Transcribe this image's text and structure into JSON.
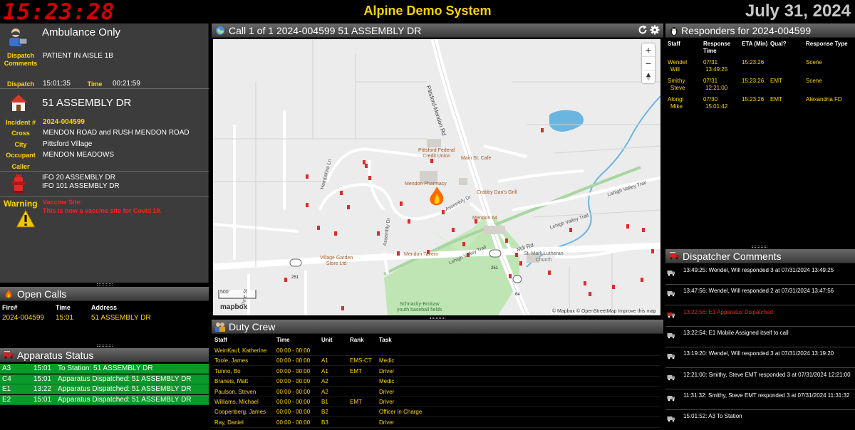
{
  "header": {
    "clock": "15:23:28",
    "system_title": "Alpine Demo System",
    "date": "July 31, 2024"
  },
  "call_info": {
    "call_type": "Ambulance Only",
    "dispatch_comments_label": "Dispatch Comments",
    "dispatch_comments": "PATIENT IN AISLE 1B",
    "dispatch_label": "Dispatch",
    "dispatch_time": "15:01:35",
    "time_label": "Time",
    "elapsed_time": "00:21:59",
    "address": "51 ASSEMBLY DR",
    "incident_label": "Incident #",
    "incident_number": "2024-004599",
    "cross_label": "Cross",
    "cross": "MENDON ROAD and RUSH MENDON ROAD",
    "city_label": "City",
    "city": "Pittsford Village",
    "occupant_label": "Occupant",
    "occupant": "MENDON MEADOWS",
    "caller_label": "Caller",
    "hydrants": [
      "IFO 20 ASSEMBLY DR",
      "IFO 101 ASSEMBLY DR"
    ],
    "warning_label": "Warning",
    "warning_title": "Vaccine Site:",
    "warning_text": "This is now a vaccine site for Covid 19."
  },
  "map_panel": {
    "title": "Call 1 of 1 2024-004599 51 ASSEMBLY DR",
    "zoom_in": "+",
    "zoom_out": "−",
    "scale": "500'",
    "attribution": "© Mapbox © OpenStreetMap  Improve this map",
    "mapbox_logo": "mapbox",
    "labels": {
      "pittsford_mendon_rd": "Pittsford-Mendon Rd",
      "hampshire_ln": "Hampshire Ln",
      "assembly_dr": "Assembly Dr",
      "lehigh_valley_trail": "Lehigh Valley Trail",
      "lehigh_valley_trail2": "Lehigh Valley Trail",
      "lehigh_valley_trail3": "Lehigh Valley Trail",
      "mill_rd": "Mill Rd",
      "pine_st": "Pine St",
      "assembly_dr2": "Assembly Dr",
      "route_251a": "251",
      "route_251b": "251",
      "route_64": "64",
      "pittsford_federal": "Pittsford Federal",
      "credit_union": "Credit Union",
      "main_st_cafe": "Main St. Cafe",
      "mendon_pharmacy": "Mendon Pharmacy",
      "crabby_dans": "Crabby Dan's Grill",
      "mendon_64": "Mendon 64",
      "village_garden": "Village Garden",
      "store_ltd": "Store Ltd",
      "mendon_tavern": "Mendon Tavern",
      "st_mark": "St. Mark Lutheran",
      "church": "Church",
      "schnacky": "Schnacky-Brokaw",
      "youth_baseball": "youth baseball fields"
    }
  },
  "responders": {
    "title": "Responders for 2024-004599",
    "columns": [
      "Staff",
      "Response Time",
      "ETA (Min)",
      "Qual?",
      "Response Type"
    ],
    "rows": [
      {
        "staff1": "Wendel",
        "staff2": "Will",
        "date": "07/31",
        "time": "13:49:25",
        "eta": "15:23:26",
        "qual": "",
        "type": "Scene"
      },
      {
        "staff1": "Smithy",
        "staff2": "Steve",
        "date": "07/31",
        "time": "12:21:00",
        "eta": "15:23:26",
        "qual": "EMT",
        "type": "Scene"
      },
      {
        "staff1": "Alongi",
        "staff2": "Mike",
        "date": "07/30",
        "time": "15:01:42",
        "eta": "15:23:26",
        "qual": "EMT",
        "type": "Alexandria FD"
      }
    ]
  },
  "dispatcher_comments": {
    "title": "Dispatcher Comments",
    "items": [
      {
        "text": "13:49:25:  Wendel, Will responded 3 at 07/31/2024 13:49:25",
        "color": "#ffffff"
      },
      {
        "text": "13:47:56:  Wendel, Will responded 2 at 07/31/2024 13:47:56",
        "color": "#ffffff"
      },
      {
        "text": "13:22:56: E1 Apparatus Dispatched",
        "color": "#ff2020"
      },
      {
        "text": "13:22:54: E1 Mobile Assigned itself to call",
        "color": "#ffffff"
      },
      {
        "text": "13:19:20:  Wendel, Will responded 3 at 07/31/2024 13:19:20",
        "color": "#ffffff"
      },
      {
        "text": "12:21:00:  Smithy, Steve EMT responded 3 at 07/31/2024 12:21:00",
        "color": "#ffffff"
      },
      {
        "text": "11:31:32:  Smithy, Steve EMT responded 3 at 07/31/2024 11:31:32",
        "color": "#ffffff"
      },
      {
        "text": "15:01:52: A3 To Station",
        "color": "#ffffff"
      }
    ]
  },
  "open_calls": {
    "title": "Open Calls",
    "columns": [
      "Fire#",
      "Time",
      "Address"
    ],
    "rows": [
      {
        "fire": "2024-004599",
        "time": "15:01",
        "address": "51 ASSEMBLY DR"
      }
    ]
  },
  "apparatus": {
    "title": "Apparatus Status",
    "rows": [
      {
        "unit": "A3",
        "time": "15:01",
        "status": "To Station: 51 ASSEMBLY DR"
      },
      {
        "unit": "C4",
        "time": "15:01",
        "status": "Apparatus Dispatched: 51 ASSEMBLY DR"
      },
      {
        "unit": "E1",
        "time": "13:22",
        "status": "Apparatus Dispatched: 51 ASSEMBLY DR"
      },
      {
        "unit": "E2",
        "time": "15:01",
        "status": "Apparatus Dispatched: 51 ASSEMBLY DR"
      }
    ]
  },
  "duty_crew": {
    "title": "Duty Crew",
    "columns": [
      "Staff",
      "Time",
      "Unit",
      "Rank",
      "Task"
    ],
    "rows": [
      {
        "staff": "WeinKauf, Katherine",
        "time": "00:00 - 00:00",
        "unit": "",
        "rank": "",
        "task": ""
      },
      {
        "staff": "Toole, James",
        "time": "00:00 - 00:00",
        "unit": "A1",
        "rank": "EMS-CT",
        "task": "Medic"
      },
      {
        "staff": "Tunno, Bo",
        "time": "00:00 - 00:00",
        "unit": "A1",
        "rank": "EMT",
        "task": "Driver"
      },
      {
        "staff": "Braneis, Matt",
        "time": "00:00 - 00:00",
        "unit": "A2",
        "rank": "",
        "task": "Medic"
      },
      {
        "staff": "Paulson, Steven",
        "time": "00:00 - 00:00",
        "unit": "A2",
        "rank": "",
        "task": "Driver"
      },
      {
        "staff": "Williams, Michael",
        "time": "00:00 - 00:00",
        "unit": "B1",
        "rank": "EMT",
        "task": "Driver"
      },
      {
        "staff": "Coopenberg, James",
        "time": "00:00 - 00:00",
        "unit": "B2",
        "rank": "",
        "task": "Officer in Charge"
      },
      {
        "staff": "Ray, Daniel",
        "time": "00:00 - 00:00",
        "unit": "B3",
        "rank": "",
        "task": "Driver"
      }
    ]
  },
  "colors": {
    "accent_yellow": "#ffd400",
    "alert_red": "#ff2020",
    "apparatus_green": "#0a9a2a",
    "panel_gray": "#3c3c3c"
  }
}
